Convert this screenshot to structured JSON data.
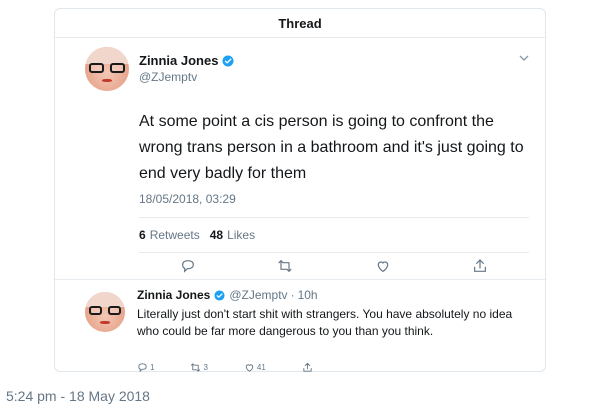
{
  "header": {
    "title": "Thread"
  },
  "main_tweet": {
    "display_name": "Zinnia Jones",
    "handle": "@ZJemptv",
    "text": "At some point a cis person is going to confront the wrong trans person in a bathroom and it's just going to end very badly for them",
    "timestamp": "18/05/2018, 03:29",
    "retweets_count": "6",
    "retweets_label": "Retweets",
    "likes_count": "48",
    "likes_label": "Likes"
  },
  "reply_tweet": {
    "display_name": "Zinnia Jones",
    "handle": "@ZJemptv",
    "separator": "·",
    "age": "10h",
    "text": "Literally just don't start shit with strangers. You have absolutely no idea who could be far more dangerous to you than you think.",
    "reply_count": "1",
    "retweet_count": "3",
    "like_count": "41"
  },
  "footer": {
    "time": "5:24 pm - 18 May 2018"
  },
  "colors": {
    "accent": "#1da1f2",
    "muted": "#657786",
    "border": "#e1e8ed"
  },
  "icons": [
    "chevron-down-icon",
    "verified-badge-icon",
    "reply-icon",
    "retweet-icon",
    "like-icon",
    "share-icon"
  ]
}
